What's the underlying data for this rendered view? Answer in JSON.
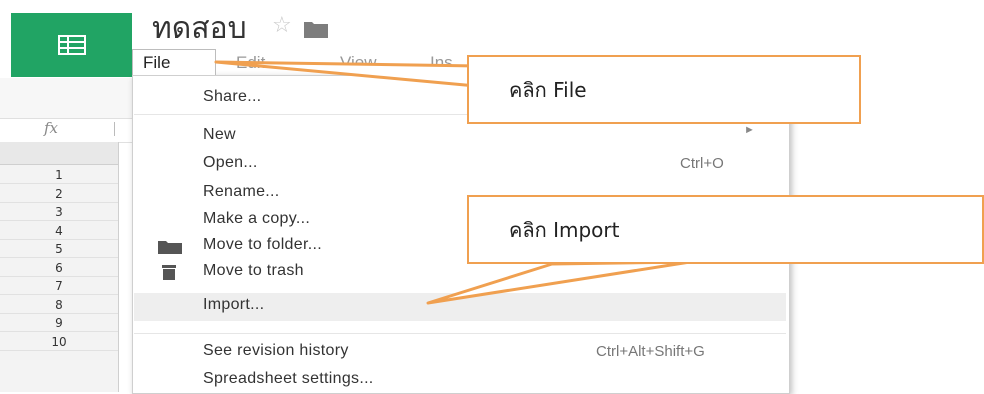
{
  "header": {
    "doc_title": "ทดสอบ"
  },
  "menubar": {
    "file_label": "File",
    "edit_label": "Edit",
    "view_label": "View",
    "insert_label": "Ins"
  },
  "formula_bar": {
    "fx_label": "fx"
  },
  "row_headers": [
    "1",
    "2",
    "3",
    "4",
    "5",
    "6",
    "7",
    "8",
    "9",
    "10"
  ],
  "file_menu": {
    "share": "Share...",
    "new": "New",
    "open": "Open...",
    "open_shortcut": "Ctrl+O",
    "rename": "Rename...",
    "make_copy": "Make a copy...",
    "move_to_folder": "Move to folder...",
    "move_to_trash": "Move to trash",
    "import": "Import...",
    "revision_history": "See revision history",
    "revision_shortcut": "Ctrl+Alt+Shift+G",
    "spreadsheet_settings": "Spreadsheet settings..."
  },
  "callouts": {
    "click_file": "คลิก File",
    "click_import": "คลิก Import"
  },
  "colors": {
    "brand_green": "#21a464",
    "callout_orange": "#f0a050"
  }
}
